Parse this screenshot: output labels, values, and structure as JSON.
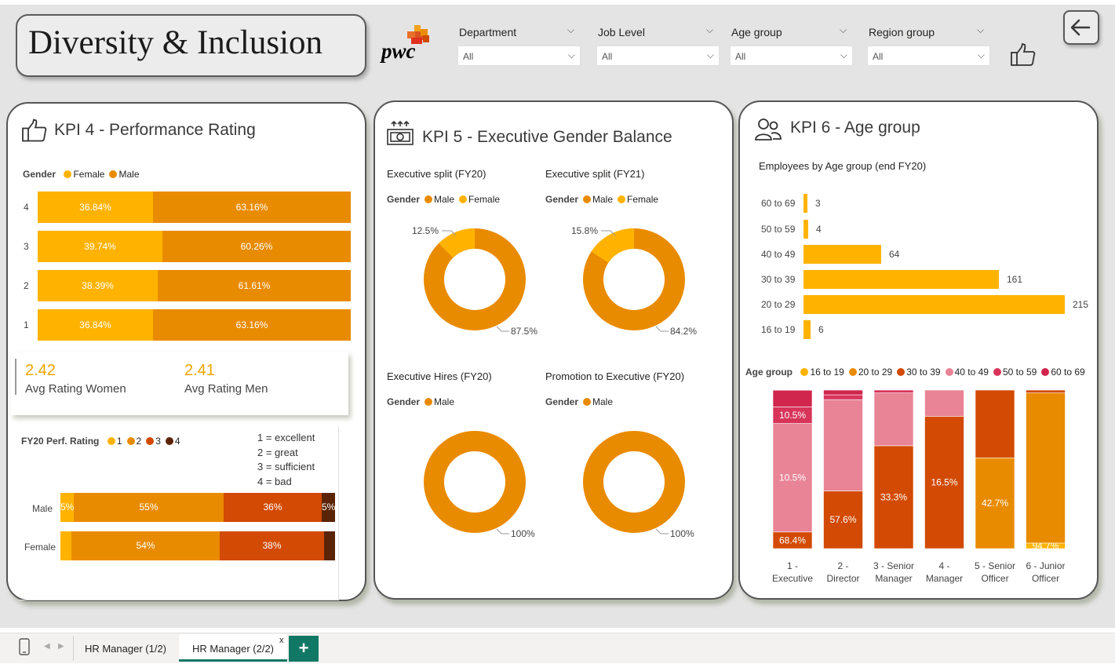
{
  "header": {
    "title": "Diversity & Inclusion",
    "logo_text": "pwc"
  },
  "filters": [
    {
      "label": "Department",
      "value": "All"
    },
    {
      "label": "Job Level",
      "value": "All"
    },
    {
      "label": "Age group",
      "value": "All"
    },
    {
      "label": "Region group",
      "value": "All"
    }
  ],
  "kpi4": {
    "title": "KPI 4 - Performance Rating",
    "legend_label": "Gender",
    "legend": [
      {
        "name": "Female",
        "color": "#FFB300"
      },
      {
        "name": "Male",
        "color": "#E98B00"
      }
    ],
    "rows": [
      {
        "rating": "4",
        "female_label": "36.84%",
        "male_label": "63.16%",
        "female": 36.84
      },
      {
        "rating": "3",
        "female_label": "39.74%",
        "male_label": "60.26%",
        "female": 39.74
      },
      {
        "rating": "2",
        "female_label": "38.39%",
        "male_label": "61.61%",
        "female": 38.39
      },
      {
        "rating": "1",
        "female_label": "36.84%",
        "male_label": "63.16%",
        "female": 36.84
      }
    ],
    "avg_women_value": "2.42",
    "avg_women_label": "Avg Rating Women",
    "avg_men_value": "2.41",
    "avg_men_label": "Avg Rating Men",
    "perf_legend_label": "FY20 Perf. Rating",
    "perf_legend": [
      {
        "name": "1",
        "color": "#FFB300"
      },
      {
        "name": "2",
        "color": "#E98B00"
      },
      {
        "name": "3",
        "color": "#D24A04"
      },
      {
        "name": "4",
        "color": "#5C2406"
      }
    ],
    "perf_notes": [
      "1 = excellent",
      "2 = great",
      "3 = sufficient",
      "4 = bad"
    ],
    "perf_rows": [
      {
        "label": "Male",
        "values": [
          5,
          55,
          36,
          5
        ],
        "labels": [
          "5%",
          "55%",
          "36%",
          "5%"
        ]
      },
      {
        "label": "Female",
        "values": [
          4,
          54,
          38,
          4
        ],
        "labels": [
          "",
          "54%",
          "38%",
          ""
        ]
      }
    ]
  },
  "kpi5": {
    "title": "KPI 5 - Executive Gender Balance",
    "gender_label": "Gender",
    "donuts": [
      {
        "title": "Executive split (FY20)",
        "legend": [
          {
            "name": "Male",
            "color": "#E98B00"
          },
          {
            "name": "Female",
            "color": "#FFB300"
          }
        ],
        "female": 12.5,
        "labels": [
          "12.5%",
          "87.5%"
        ]
      },
      {
        "title": "Executive split (FY21)",
        "legend": [
          {
            "name": "Male",
            "color": "#E98B00"
          },
          {
            "name": "Female",
            "color": "#FFB300"
          }
        ],
        "female": 15.8,
        "labels": [
          "15.8%",
          "84.2%"
        ]
      },
      {
        "title": "Executive Hires (FY20)",
        "legend": [
          {
            "name": "Male",
            "color": "#E98B00"
          }
        ],
        "female": 0,
        "labels": [
          "",
          "100%"
        ]
      },
      {
        "title": "Promotion to Executive (FY20)",
        "legend": [
          {
            "name": "Male",
            "color": "#E98B00"
          }
        ],
        "female": 0,
        "labels": [
          "",
          "100%"
        ]
      }
    ]
  },
  "kpi6": {
    "title": "KPI 6 - Age group",
    "bar_title": "Employees by Age group (end FY20)",
    "age_bars": [
      {
        "group": "60 to 69",
        "value": 3
      },
      {
        "group": "50 to 59",
        "value": 4
      },
      {
        "group": "40 to 49",
        "value": 64
      },
      {
        "group": "30 to 39",
        "value": 161
      },
      {
        "group": "20 to 29",
        "value": 215
      },
      {
        "group": "16 to 19",
        "value": 6
      }
    ],
    "stack_legend_label": "Age group",
    "stack_legend": [
      {
        "name": "16 to 19",
        "color": "#FFB300"
      },
      {
        "name": "20 to 29",
        "color": "#E98B00"
      },
      {
        "name": "30 to 39",
        "color": "#D24A04"
      },
      {
        "name": "40 to 49",
        "color": "#E88496"
      },
      {
        "name": "50 to 59",
        "color": "#D8345A"
      },
      {
        "name": "60 to 69",
        "color": "#D0264E"
      }
    ],
    "chart_data": {
      "type": "bar",
      "stacked": "100%",
      "categories": [
        "1 - Executive",
        "2 - Director",
        "3 - Senior Manager",
        "4 - Manager",
        "5 - Senior Officer",
        "6 - Junior Officer"
      ],
      "series": [
        {
          "name": "16 to 19",
          "values": [
            0,
            0,
            0,
            0,
            0,
            3.5
          ]
        },
        {
          "name": "20 to 29",
          "values": [
            0,
            0,
            0,
            0,
            57.3,
            94.7
          ]
        },
        {
          "name": "30 to 39",
          "values": [
            10.5,
            36.4,
            64.9,
            83.5,
            42.7,
            1.8
          ]
        },
        {
          "name": "40 to 49",
          "values": [
            68.4,
            57.6,
            33.3,
            16.5,
            0,
            0
          ]
        },
        {
          "name": "50 to 59",
          "values": [
            10.5,
            3.0,
            1.8,
            0,
            0,
            0
          ]
        },
        {
          "name": "60 to 69",
          "values": [
            10.5,
            3.0,
            0,
            0,
            0,
            0
          ]
        }
      ],
      "labels": [
        [
          "",
          "",
          "10.5%",
          "68.4%",
          "10.5%",
          "10.5%"
        ],
        [
          "",
          "",
          "36.4%",
          "57.6%",
          "",
          ""
        ],
        [
          "",
          "",
          "64.9%",
          "33.3%",
          "",
          ""
        ],
        [
          "",
          "",
          "83.5%",
          "16.5%",
          "",
          ""
        ],
        [
          "",
          "57.3%",
          "42.7%",
          "",
          "",
          ""
        ],
        [
          "",
          "94.7%",
          "",
          "",
          "",
          ""
        ]
      ]
    }
  },
  "tabs": [
    {
      "label": "HR Manager (1/2)"
    },
    {
      "label": "HR Manager (2/2)"
    }
  ],
  "tab_close": "x",
  "add_tab": "+"
}
